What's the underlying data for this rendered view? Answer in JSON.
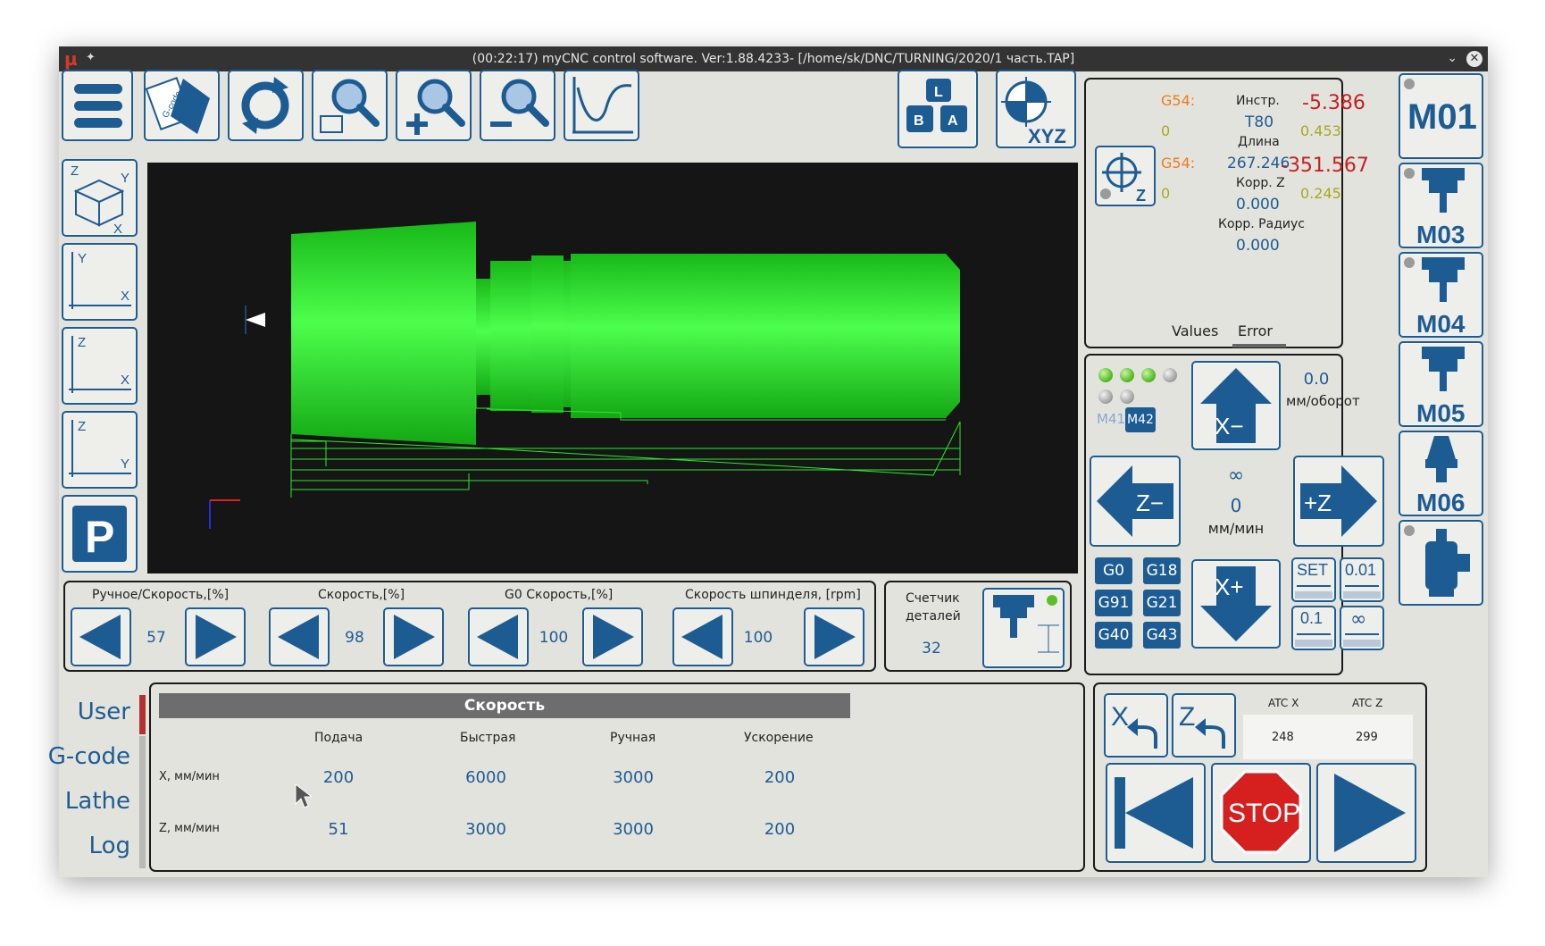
{
  "window": {
    "title": "(00:22:17) myCNC control software. Ver:1.88.4233- [/home/sk/DNC/TURNING/2020/1 часть.TAP]",
    "logo": "µ"
  },
  "toolbar": {
    "gcode_icon_text": "G-code",
    "wcs_icon_text": "XYZ",
    "layout_keys": [
      "L",
      "B",
      "A"
    ]
  },
  "views": {
    "iso": [
      "Z",
      "Y",
      "X"
    ],
    "xy": [
      "Y",
      "X"
    ],
    "xz": [
      "Z",
      "X"
    ],
    "yz": [
      "Z",
      "Y"
    ],
    "park": "P"
  },
  "coords": {
    "wcs1": "G54:",
    "wcs1_sub": "0",
    "wcs2": "G54:",
    "wcs2_sub": "0",
    "tool_label": "Инстр.",
    "tool_value": "T80",
    "length_label": "Длина",
    "length_value": "267.246",
    "corrz_label": "Корр. Z",
    "corrz_value": "0.000",
    "corrr_label": "Корр. Радиус",
    "corrr_value": "0.000",
    "x_pos": "-5.386",
    "x_sub": "0.453",
    "z_pos": "-351.567",
    "z_sub": "0.245",
    "zero_icon_text": "Z",
    "tabs": [
      "Values",
      "Error"
    ]
  },
  "jog": {
    "feed_rev": "0.0",
    "feed_rev_unit": "мм/оборот",
    "infinity": "∞",
    "feed": "0",
    "feed_unit": "мм/мин",
    "m41": "M41",
    "m42": "M42",
    "x_minus": "X−",
    "x_plus": "X+",
    "z_minus": "Z−",
    "z_plus": "+Z",
    "gcodes": [
      "G0",
      "G18",
      "G91",
      "G21",
      "G40",
      "G43"
    ],
    "steps": [
      "SET",
      "0.01",
      "0.1",
      "∞"
    ]
  },
  "mcodes": [
    "M01",
    "M03",
    "M04",
    "M05",
    "M06"
  ],
  "speeds": [
    {
      "label": "Ручное/Скорость,[%]",
      "value": "57"
    },
    {
      "label": "Скорость,[%]",
      "value": "98"
    },
    {
      "label": "G0 Скорость,[%]",
      "value": "100"
    },
    {
      "label": "Скорость шпинделя, [rpm]",
      "value": "100"
    }
  ],
  "counter": {
    "label1": "Счетчик",
    "label2": "деталей",
    "value": "32"
  },
  "nav": [
    "User",
    "G-code",
    "Lathe",
    "Log"
  ],
  "table": {
    "title": "Скорость",
    "columns": [
      "Подача",
      "Быстрая",
      "Ручная",
      "Ускорение"
    ],
    "rows": [
      {
        "label": "X, мм/мин",
        "values": [
          "200",
          "6000",
          "3000",
          "200"
        ]
      },
      {
        "label": "Z, мм/мин",
        "values": [
          "51",
          "3000",
          "3000",
          "200"
        ]
      }
    ]
  },
  "atc": {
    "x_label": "ATC X",
    "z_label": "ATC Z",
    "x_value": "248",
    "z_value": "299"
  },
  "run": {
    "stop": "STOP"
  },
  "colors": {
    "accent": "#1d5c93",
    "part": "#2ee82e",
    "stop": "#d61f1f",
    "coord_red": "#c81e1e",
    "wcs": "#f07a1a",
    "sub": "#a6a91d"
  }
}
